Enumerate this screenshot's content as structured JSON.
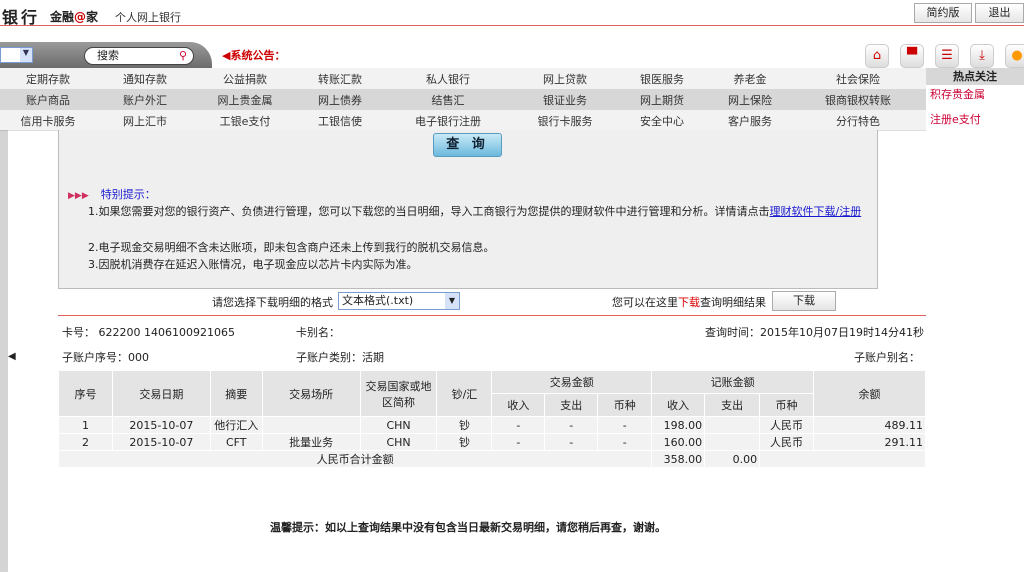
{
  "header": {
    "brand": "银行",
    "brand_sub_1": "金融",
    "brand_sub_at": "@",
    "brand_sub_2": "家",
    "title": "个人网上银行",
    "simple_btn": "简约版",
    "logout_btn": "退出"
  },
  "toolbar": {
    "search_placeholder": "搜索",
    "notice_label": "系统公告：",
    "icons": [
      "home-icon",
      "cart-icon",
      "contacts-icon",
      "download-icon",
      "service-icon"
    ]
  },
  "menu": [
    [
      "定期存款",
      "通知存款",
      "公益捐款",
      "转账汇款",
      "私人银行",
      "网上贷款",
      "银医服务",
      "养老金",
      "社会保险"
    ],
    [
      "账户商品",
      "账户外汇",
      "网上贵金属",
      "网上债券",
      "结售汇",
      "银证业务",
      "网上期货",
      "网上保险",
      "银商银权转账"
    ],
    [
      "信用卡服务",
      "网上汇市",
      "工银e支付",
      "工银信使",
      "电子银行注册",
      "银行卡服务",
      "安全中心",
      "客户服务",
      "分行特色"
    ]
  ],
  "hot": {
    "title": "热点关注",
    "items": [
      "积存贵金属",
      "注册e支付"
    ]
  },
  "query_btn": "查 询",
  "tips": {
    "heading": "特别提示：",
    "t1": "1.如果您需要对您的银行资产、负债进行管理，您可以下载您的当日明细，导入工商银行为您提供的理财软件中进行管理和分析。详情请点击",
    "t1_link": "理财软件下载/注册",
    "t2": "2.电子现金交易明细不含未达账项，即未包含商户还未上传到我行的脱机交易信息。",
    "t3": "3.因脱机消费存在延迟入账情况，电子现金应以芯片卡内实际为准。"
  },
  "download": {
    "format_label": "请您选择下载明细的格式",
    "format_value": "文本格式(.txt)",
    "text_pre": "您可以在这里",
    "text_red": "下载",
    "text_post": "查询明细结果",
    "button": "下载"
  },
  "account": {
    "card_no": "卡号： 622200 1406100921065",
    "card_alias": "卡别名：",
    "query_time": "查询时间：2015年10月07日19时14分41秒",
    "sub_no": "子账户序号：000",
    "sub_type": "子账户类别：活期",
    "sub_alias": "子账户别名："
  },
  "table": {
    "h": {
      "seq": "序号",
      "date": "交易日期",
      "summary": "摘要",
      "place": "交易场所",
      "country": "交易国家或地区简称",
      "cash": "钞/汇",
      "trade_amt": "交易金额",
      "book_amt": "记账金额",
      "balance": "余额",
      "in": "收入",
      "out": "支出",
      "cur": "币种"
    },
    "rows": [
      {
        "seq": "1",
        "date": "2015-10-07",
        "summary": "他行汇入",
        "place": "",
        "country": "CHN",
        "cash": "钞",
        "t_in": "-",
        "t_out": "-",
        "t_cur": "-",
        "b_in": "198.00",
        "b_out": "",
        "b_cur": "人民币",
        "balance": "489.11"
      },
      {
        "seq": "2",
        "date": "2015-10-07",
        "summary": "CFT",
        "place": "批量业务",
        "country": "CHN",
        "cash": "钞",
        "t_in": "-",
        "t_out": "-",
        "t_cur": "-",
        "b_in": "160.00",
        "b_out": "",
        "b_cur": "人民币",
        "balance": "291.11"
      }
    ],
    "total": {
      "label": "人民币合计金额",
      "in": "358.00",
      "out": "0.00"
    }
  },
  "warm_tip": "温馨提示：如以上查询结果中没有包含当日最新交易明细，请您稍后再查，谢谢。"
}
